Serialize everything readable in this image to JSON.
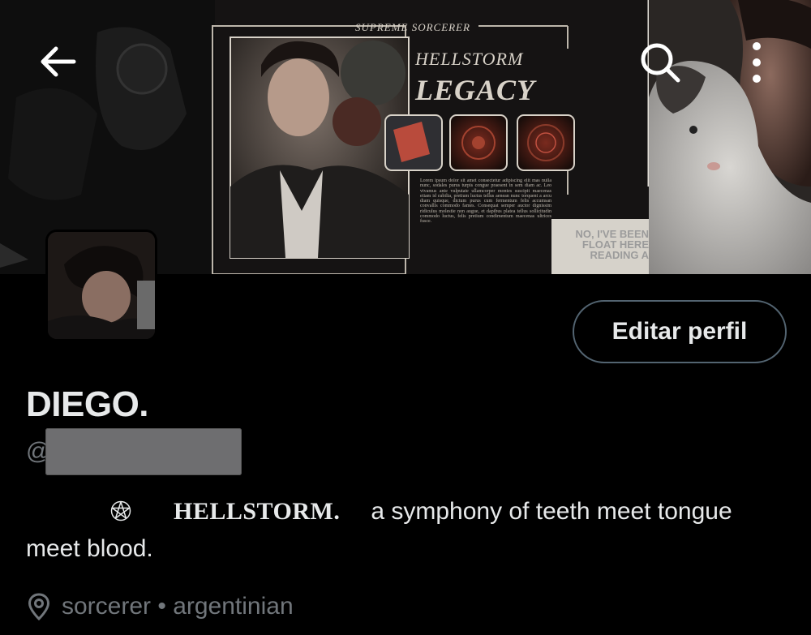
{
  "header": {
    "back_icon": "arrow-left-icon",
    "search_icon": "search-icon",
    "more_icon": "more-vertical-icon"
  },
  "banner": {
    "frame_label": "SUPREME  SORCERER",
    "title_line1": "HELLSTORM",
    "title_line2": "LEGACY",
    "lorem": "Lorem ipsum dolor sit amet consectetur adipiscing elit mas nulla nunc, sodales purus turpis congue praesent in sem diam ac. Leo vivamus ante vulputate ullamcorper montes suscipit maecenas etiam id cubilia, pretium luctus tellus aenean nunc torquent a arcu diam quisque, dictum purus cum fermentum felis accumsan convallis commodo fames. Consequat semper auctor dignissim ridiculus molestie non augue, et dapibus platea tellus sollicitudin commodo luctus, felis pretium condimentum maecenas ultrices fusce.",
    "comic_text": "NO, I'VE BEEN FLOAT HERE READING A"
  },
  "profile": {
    "edit_button": "Editar perfil",
    "display_name": "DIEGO.",
    "handle_prefix": "@",
    "bio_name": "HELLSTORM.",
    "bio_text": "a symphony of teeth meet tongue meet blood.",
    "location": "sorcerer • argentinian"
  },
  "colors": {
    "background": "#000000",
    "text_primary": "#e7e9ea",
    "text_secondary": "#71767b",
    "button_border": "#536471"
  }
}
